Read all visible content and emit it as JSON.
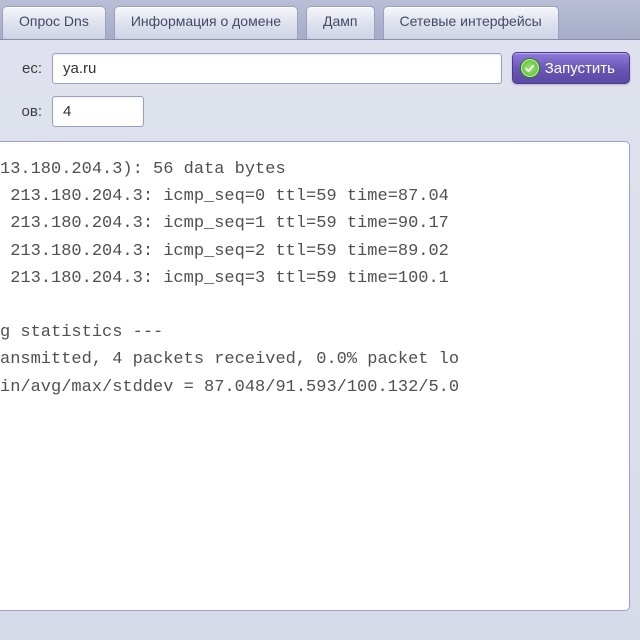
{
  "tabs": [
    {
      "label": "Опрос Dns"
    },
    {
      "label": "Информация о домене"
    },
    {
      "label": "Дамп"
    },
    {
      "label": "Сетевые интерфейсы"
    }
  ],
  "form": {
    "address_label_suffix": "eс:",
    "address_value": "ya.ru",
    "count_label_suffix": "oв:",
    "count_value": "4",
    "run_label": "Запустить"
  },
  "output_lines": [
    "13.180.204.3): 56 data bytes",
    " 213.180.204.3: icmp_seq=0 ttl=59 time=87.04",
    " 213.180.204.3: icmp_seq=1 ttl=59 time=90.17",
    " 213.180.204.3: icmp_seq=2 ttl=59 time=89.02",
    " 213.180.204.3: icmp_seq=3 ttl=59 time=100.1",
    "",
    "g statistics ---",
    "ansmitted, 4 packets received, 0.0% packet lo",
    "in/avg/max/stddev = 87.048/91.593/100.132/5.0"
  ]
}
